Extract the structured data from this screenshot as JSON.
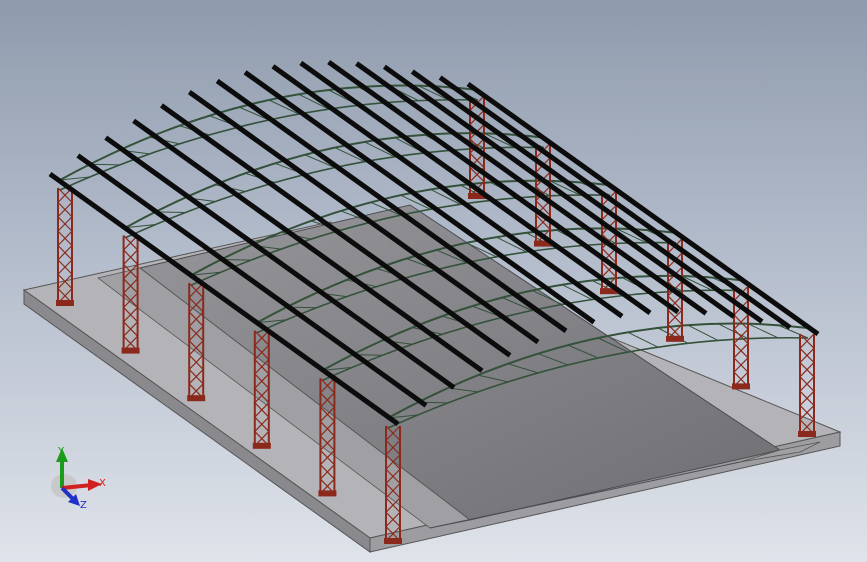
{
  "viewport": {
    "background_top": "#8f9bad",
    "background_bottom": "#dfe3ea"
  },
  "model": {
    "slab_color": "#a9a9ad",
    "floor_color": "#7b7b80",
    "column_color": "#8b2a1c",
    "truss_color": "#34513a",
    "purlin_color": "#0c0c0c"
  },
  "triad": {
    "x_label": "X",
    "y_label": "Y",
    "z_label": "Z",
    "x_color": "#d02020",
    "y_color": "#1a9c1a",
    "z_color": "#2030c8"
  }
}
